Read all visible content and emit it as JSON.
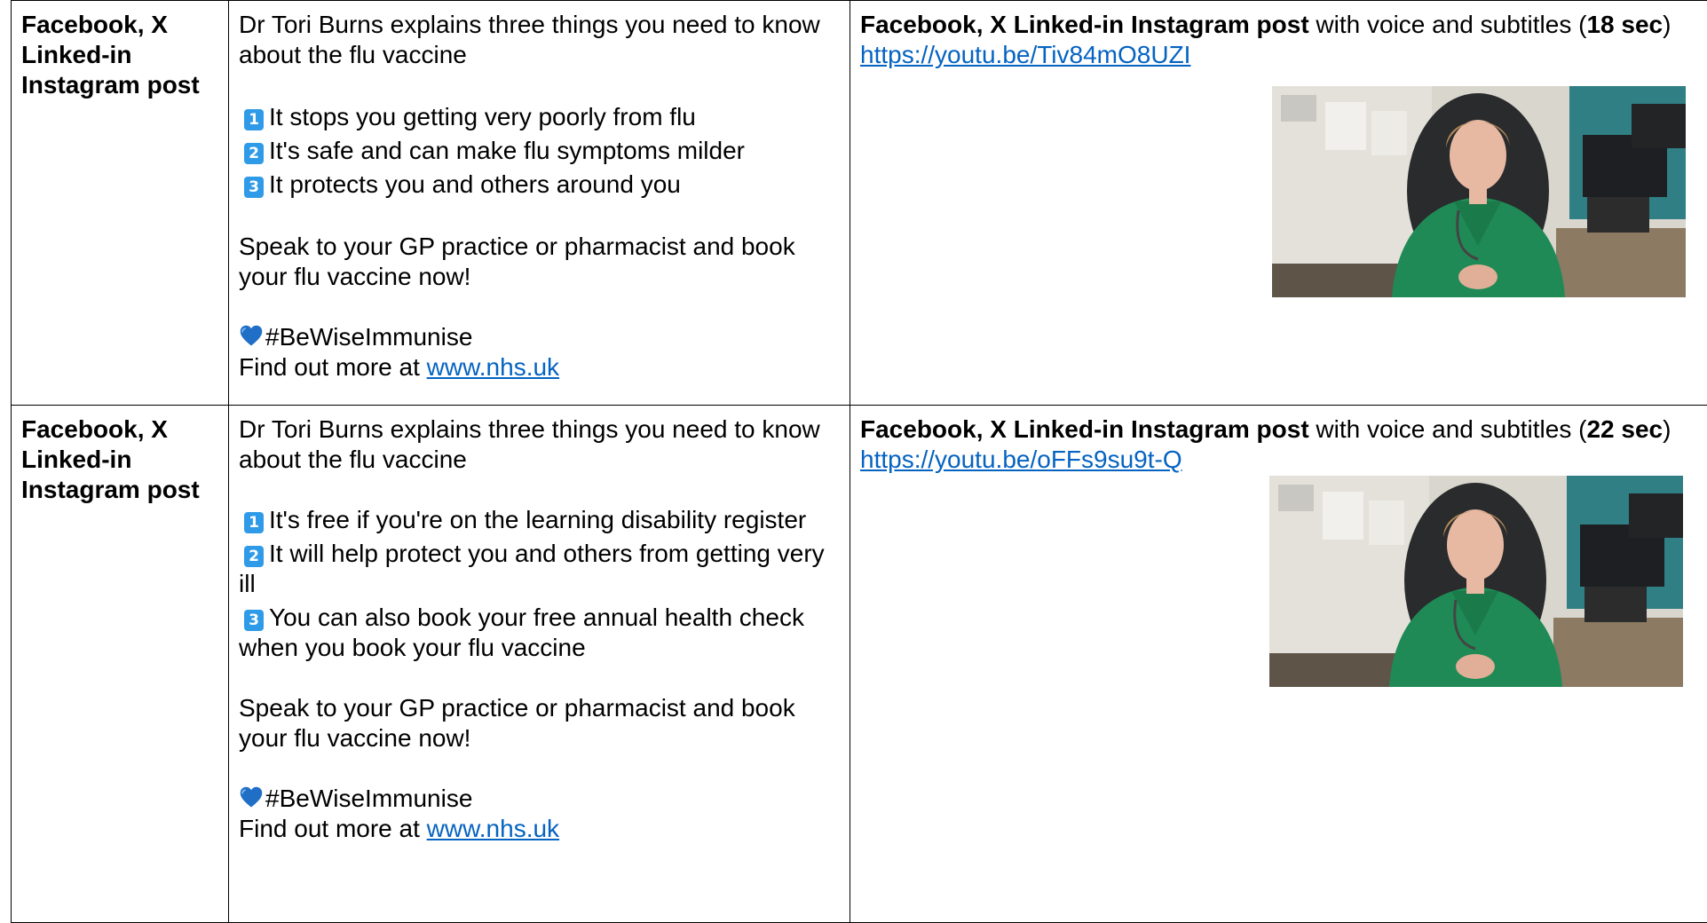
{
  "rows": [
    {
      "platform": "Facebook, X Linked-in Instagram post",
      "post": {
        "intro": "Dr Tori Burns explains three things you need to know about the flu vaccine",
        "items": [
          {
            "num": "1",
            "text": "It stops you getting very poorly from flu"
          },
          {
            "num": "2",
            "text": "It's safe and can make flu symptoms milder"
          },
          {
            "num": "3",
            "text": "It protects you and others around you"
          }
        ],
        "cta": "Speak to your GP practice or pharmacist and book your flu vaccine now!",
        "hashtag": "#BeWiseImmunise",
        "more_prefix": "Find out more at ",
        "more_link": "www.nhs.uk"
      },
      "asset": {
        "title_bold": "Facebook, X Linked-in Instagram post",
        "title_rest": " with voice and subtitles (",
        "duration": "18 sec",
        "close": ")",
        "url": "https://youtu.be/Tiv84mO8UZI"
      }
    },
    {
      "platform": "Facebook, X Linked-in Instagram post",
      "post": {
        "intro": "Dr Tori Burns explains three things you need to know about the flu vaccine",
        "items": [
          {
            "num": "1",
            "text": "It's free if you're on the learning disability register"
          },
          {
            "num": "2",
            "text": "It will help protect you and others from getting very ill"
          },
          {
            "num": "3",
            "text": "You can also book your free annual health check when you book your flu vaccine"
          }
        ],
        "cta": "Speak to your GP practice or pharmacist and book your flu vaccine now!",
        "hashtag": "#BeWiseImmunise",
        "more_prefix": "Find out more at ",
        "more_link": "www.nhs.uk"
      },
      "asset": {
        "title_bold": "Facebook, X Linked-in Instagram post",
        "title_rest": " with voice and subtitles (",
        "duration": "22 sec",
        "close": ")",
        "url": "https://youtu.be/oFFs9su9t-Q"
      }
    }
  ],
  "colors": {
    "link": "#0563c1",
    "number_badge": "#2f9be8",
    "heart": "#1f6fc6",
    "border": "#000000"
  },
  "icons": {
    "number_badge": "keycap-number-icon",
    "heart": "blue-heart-icon"
  }
}
